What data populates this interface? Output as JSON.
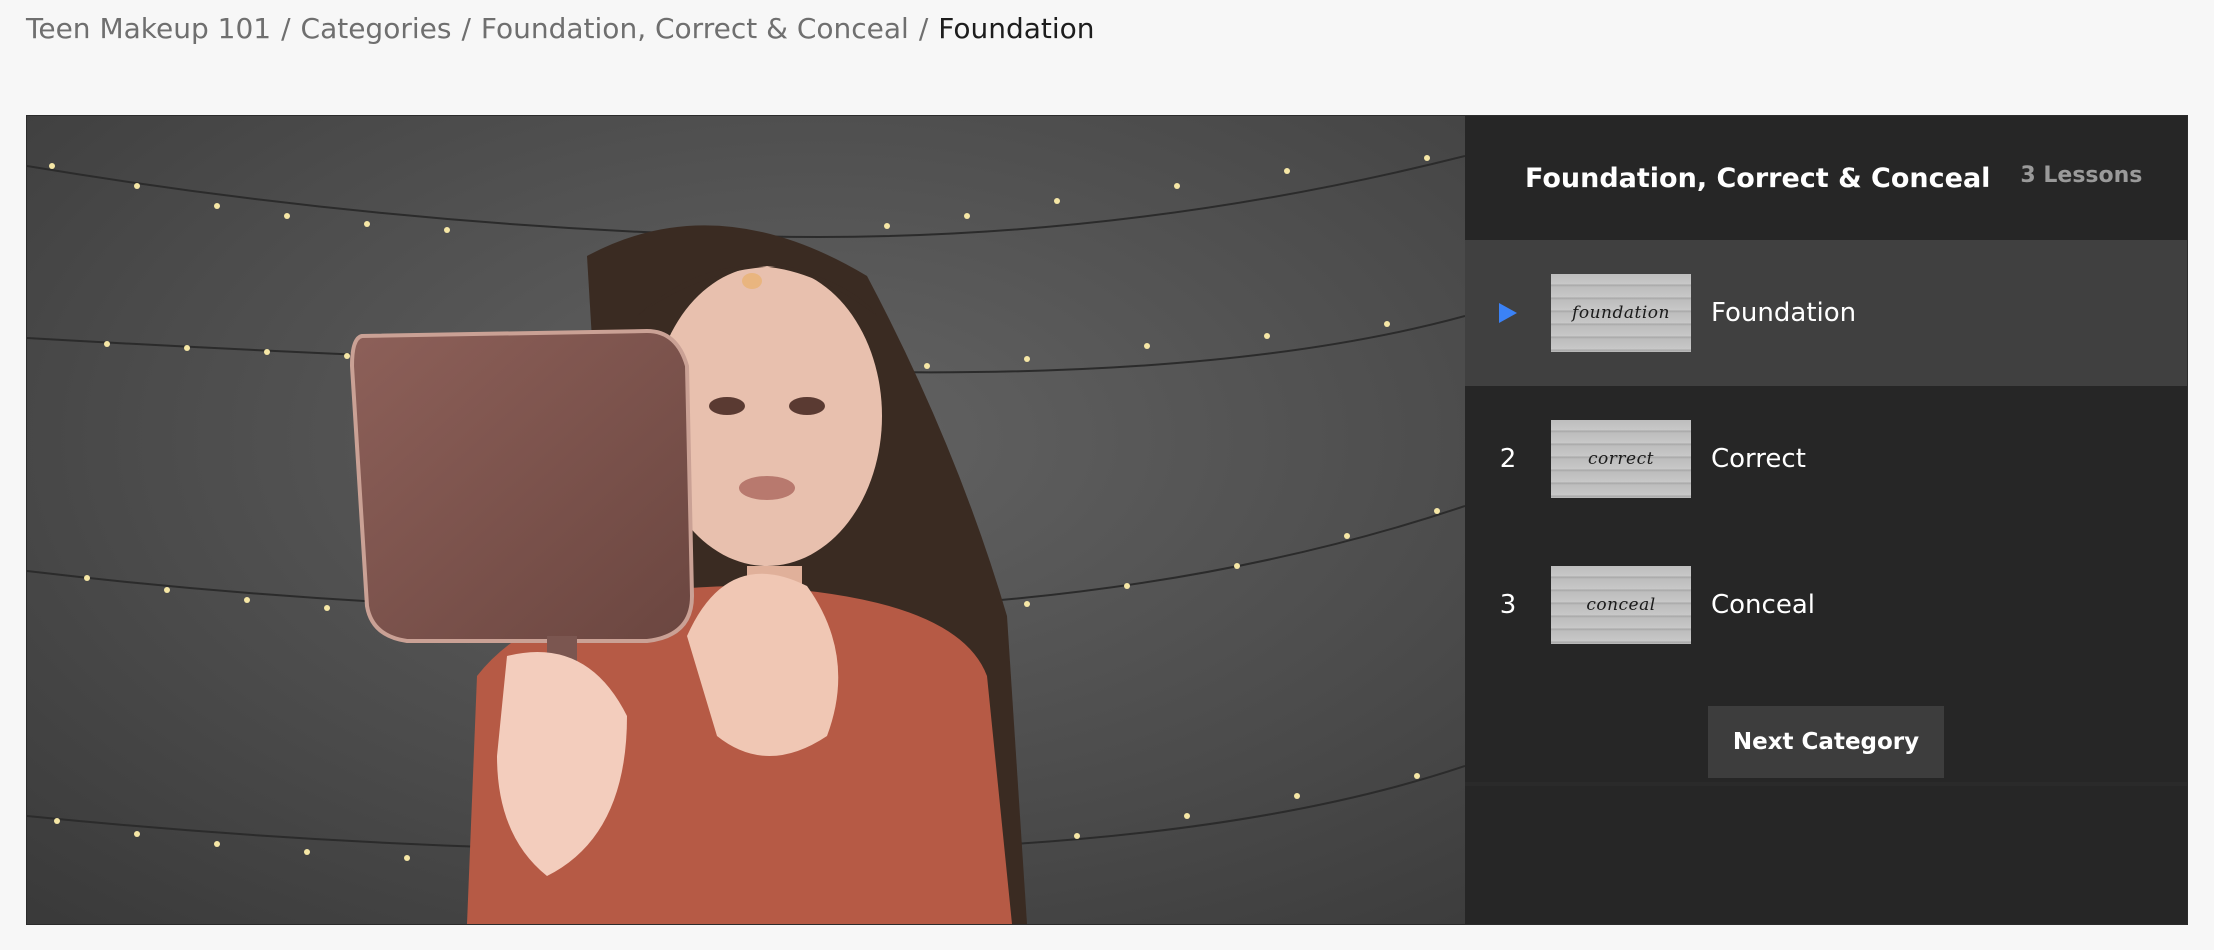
{
  "breadcrumb": {
    "items": [
      "Teen Makeup 101",
      "Categories",
      "Foundation, Correct & Conceal"
    ],
    "separator": "/",
    "current": "Foundation"
  },
  "sidebar": {
    "title": "Foundation, Correct & Conceal",
    "count": "3 Lessons",
    "lessons": [
      {
        "index": "",
        "thumb_text": "foundation",
        "title": "Foundation",
        "active": true
      },
      {
        "index": "2",
        "thumb_text": "correct",
        "title": "Correct",
        "active": false
      },
      {
        "index": "3",
        "thumb_text": "conceal",
        "title": "Conceal",
        "active": false
      }
    ],
    "next_label": "Next Category"
  },
  "colors": {
    "accent": "#3b82f6",
    "sidebar_bg": "#262626",
    "active_row": "#404040",
    "button_bg": "#3d3d3d"
  }
}
